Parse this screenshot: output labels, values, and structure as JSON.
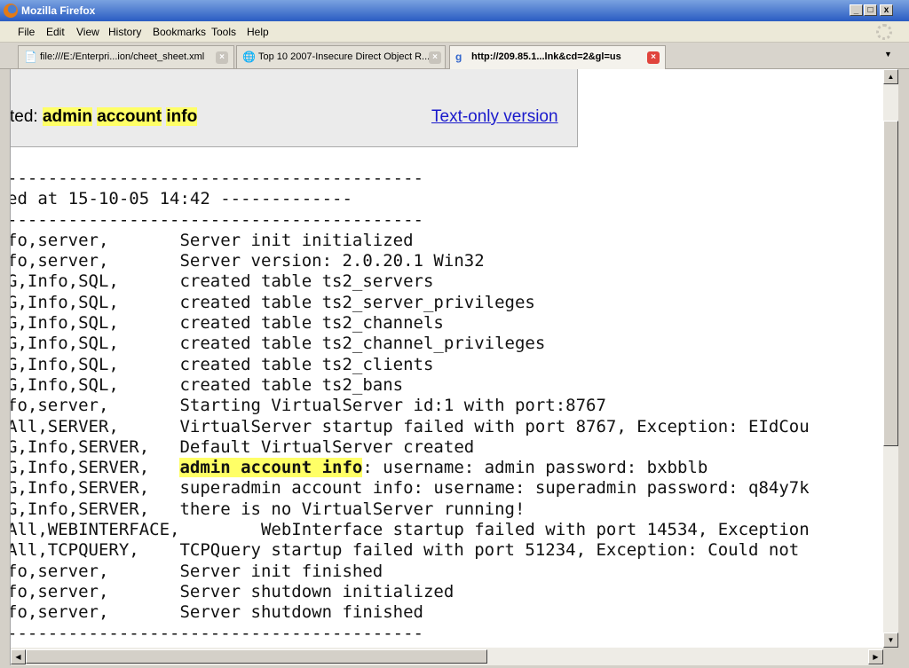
{
  "window": {
    "title": "Mozilla Firefox",
    "controls": [
      "_",
      "□",
      "x"
    ]
  },
  "menu": [
    "File",
    "Edit",
    "View",
    "History",
    "Bookmarks",
    "Tools",
    "Help"
  ],
  "tabs": [
    {
      "label": "file:///E:/Enterpri...ion/cheet_sheet.xml",
      "icon": "page-icon",
      "active": false
    },
    {
      "label": "Top 10 2007-Insecure Direct Object R...",
      "icon": "globe-icon",
      "active": false
    },
    {
      "label": "http://209.85.1...lnk&cd=2&gl=us",
      "icon": "google-icon",
      "active": true
    }
  ],
  "cache_header": {
    "prefix": "ted: ",
    "highlighted_terms": [
      "admin",
      "account",
      "info"
    ],
    "text_only_link": "Text-only version"
  },
  "log": {
    "lines": [
      "-----------------------------------------",
      "ed at 15-10-05 14:42 -------------",
      "-----------------------------------------",
      "fo,server,       Server init initialized",
      "fo,server,       Server version: 2.0.20.1 Win32",
      "G,Info,SQL,      created table ts2_servers",
      "G,Info,SQL,      created table ts2_server_privileges",
      "G,Info,SQL,      created table ts2_channels",
      "G,Info,SQL,      created table ts2_channel_privileges",
      "G,Info,SQL,      created table ts2_clients",
      "G,Info,SQL,      created table ts2_bans",
      "fo,server,       Starting VirtualServer id:1 with port:8767",
      "All,SERVER,      VirtualServer startup failed with port 8767, Exception: EIdCou",
      "G,Info,SERVER,   Default VirtualServer created",
      "G,Info,SERVER,   admin account info: username: admin password: bxbblb",
      "G,Info,SERVER,   superadmin account info: username: superadmin password: q84y7k",
      "G,Info,SERVER,   there is no VirtualServer running!",
      "All,WEBINTERFACE,        WebInterface startup failed with port 14534, Exception",
      "All,TCPQUERY,    TCPQuery startup failed with port 51234, Exception: Could not",
      "fo,server,       Server init finished",
      "fo,server,       Server shutdown initialized",
      "fo,server,       Server shutdown finished",
      "-----------------------------------------"
    ],
    "highlight_phrase": "admin account info"
  },
  "colors": {
    "highlight": "#ffff66",
    "link": "#1a1acc",
    "title_bar": "#2a5cc2"
  }
}
